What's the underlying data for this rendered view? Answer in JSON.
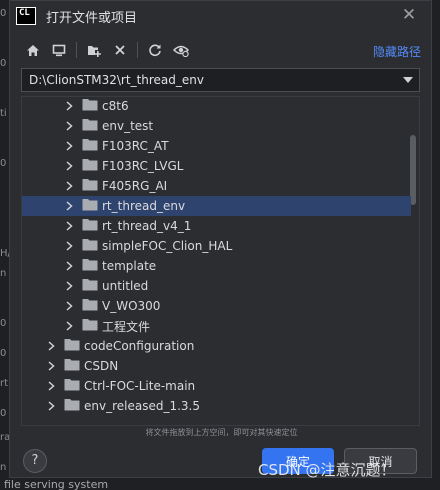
{
  "dialog": {
    "app_icon": "CL",
    "title": "打开文件或项目",
    "hide_path_label": "隐藏路径"
  },
  "toolbar": {
    "buttons": [
      "home-icon",
      "desktop-icon",
      "new-folder-icon",
      "delete-icon",
      "refresh-icon",
      "show-hidden-icon"
    ]
  },
  "path": {
    "value": "D:\\ClionSTM32\\rt_thread_env"
  },
  "tree": {
    "items": [
      {
        "label": "c8t6",
        "depth": 1,
        "selected": false
      },
      {
        "label": "env_test",
        "depth": 1,
        "selected": false
      },
      {
        "label": "F103RC_AT",
        "depth": 1,
        "selected": false
      },
      {
        "label": "F103RC_LVGL",
        "depth": 1,
        "selected": false
      },
      {
        "label": "F405RG_AI",
        "depth": 1,
        "selected": false
      },
      {
        "label": "rt_thread_env",
        "depth": 1,
        "selected": true
      },
      {
        "label": "rt_thread_v4_1",
        "depth": 1,
        "selected": false
      },
      {
        "label": "simpleFOC_Clion_HAL",
        "depth": 1,
        "selected": false
      },
      {
        "label": "template",
        "depth": 1,
        "selected": false
      },
      {
        "label": "untitled",
        "depth": 1,
        "selected": false
      },
      {
        "label": "V_WO300",
        "depth": 1,
        "selected": false
      },
      {
        "label": "工程文件",
        "depth": 1,
        "selected": false
      },
      {
        "label": "codeConfiguration",
        "depth": 0,
        "selected": false
      },
      {
        "label": "CSDN",
        "depth": 0,
        "selected": false
      },
      {
        "label": "Ctrl-FOC-Lite-main",
        "depth": 0,
        "selected": false
      },
      {
        "label": "env_released_1.3.5",
        "depth": 0,
        "selected": false
      }
    ]
  },
  "hint": "将文件拖放到上方空间，即可对其快速定位",
  "buttons": {
    "help": "?",
    "ok": "确定",
    "cancel": "取消"
  },
  "watermark": "CSDN @注意沉题！",
  "background": {
    "left_chars": [
      "0",
      "0",
      "ti",
      "0",
      "H/",
      "n",
      "0",
      "0",
      "rt",
      "0",
      "ra",
      "n"
    ],
    "bottom_text": "file serving system"
  },
  "colors": {
    "accent": "#3574f0",
    "selection": "#2e436e",
    "link": "#548af7",
    "folder": "#a9acb0"
  }
}
